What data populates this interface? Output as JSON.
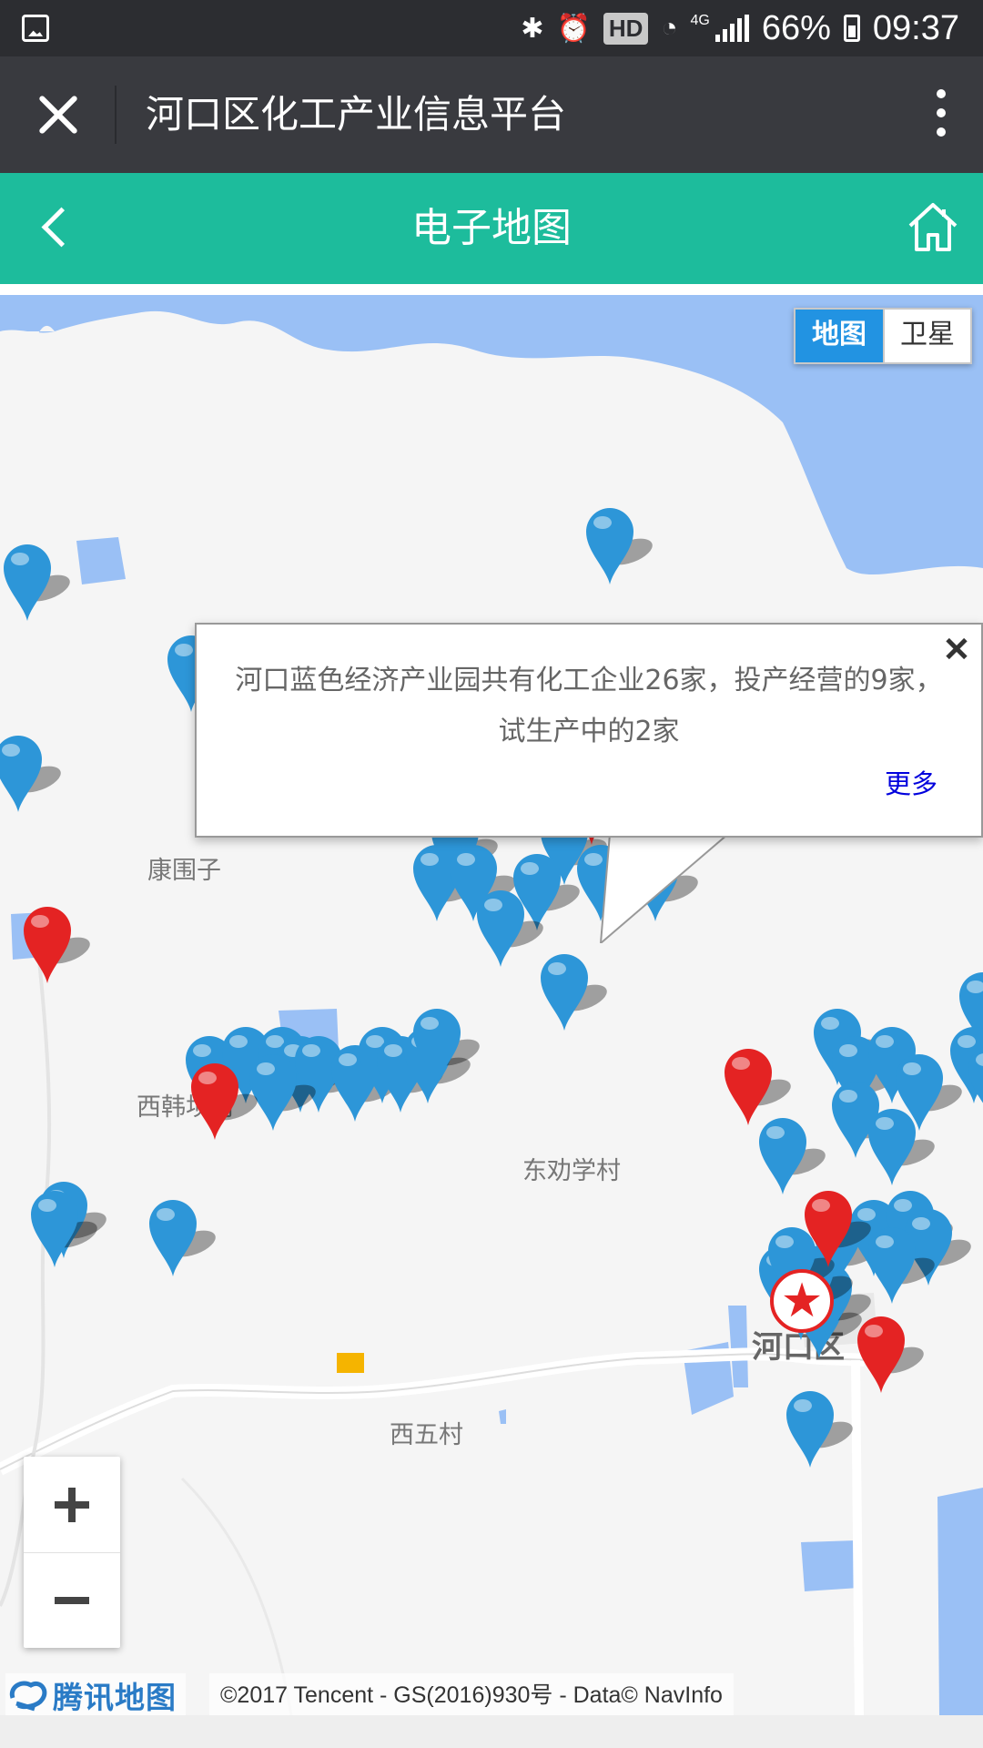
{
  "status_bar": {
    "battery": "66%",
    "time": "09:37",
    "hd_badge": "HD",
    "network": "4G",
    "icons": [
      "gallery-icon",
      "bluetooth-icon",
      "alarm-icon",
      "wifi-icon",
      "signal-icon",
      "battery-icon"
    ]
  },
  "title_bar": {
    "title": "河口区化工产业信息平台",
    "icons": [
      "close-icon",
      "more-icon"
    ]
  },
  "header": {
    "title": "电子地图",
    "icons": [
      "back-icon",
      "home-icon"
    ],
    "color": "#1dbc9c"
  },
  "map": {
    "type_toggle": {
      "active": "地图",
      "inactive": "卫星"
    },
    "places": [
      "康围子",
      "西韩坝村",
      "东劝学村",
      "西五村",
      "河口区"
    ],
    "info_window": {
      "text": "河口蓝色经济产业园共有化工企业26家，投产经营的9家，试生产中的2家",
      "more": "更多"
    },
    "zoom": {
      "in": "+",
      "out": "−"
    },
    "attribution": {
      "logo_text": "腾讯地图",
      "copyright": "©2017 Tencent - GS(2016)930号 - Data© NavInfo"
    },
    "marker_colors": {
      "blue": "#2d96d8",
      "red": "#e42323"
    }
  }
}
